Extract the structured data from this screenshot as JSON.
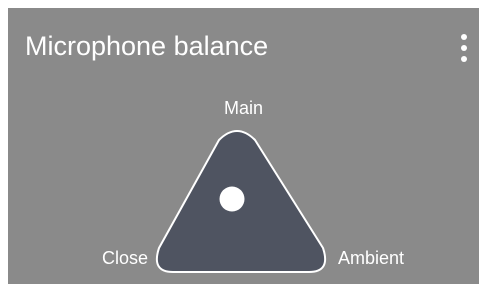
{
  "panel": {
    "title": "Microphone balance",
    "menu_icon": "more-vertical-icon"
  },
  "balance_pad": {
    "shape": "triangle",
    "fill_color": "#4f5461",
    "outline_color": "#ffffff",
    "labels": {
      "top": "Main",
      "left": "Close",
      "right": "Ambient"
    },
    "handle_color": "#ffffff"
  },
  "colors": {
    "background": "#8a8a8a",
    "text": "#ffffff"
  }
}
